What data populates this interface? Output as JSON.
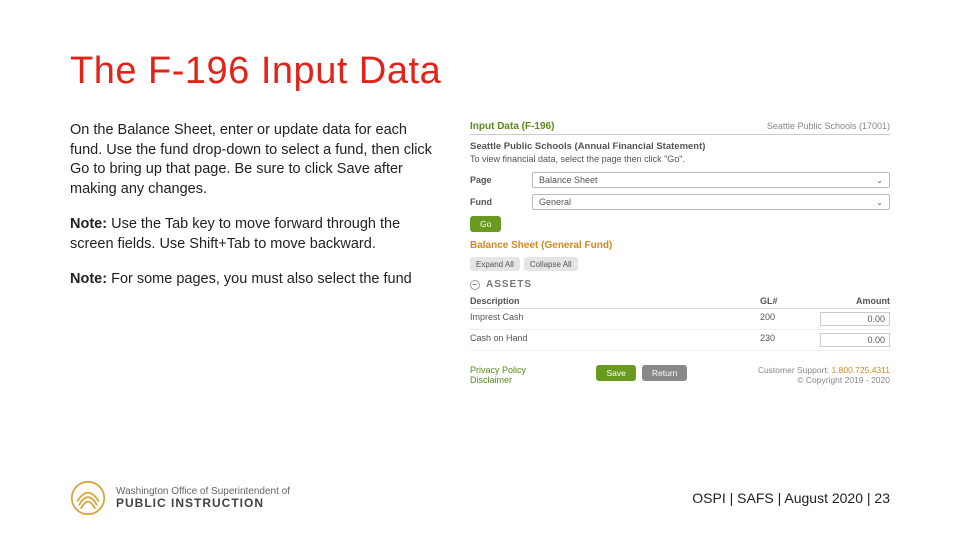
{
  "title": "The F-196 Input Data",
  "left": {
    "p1": "On the Balance Sheet, enter or update data for each fund. Use the fund drop-down to select a fund, then click Go to bring up that page. Be sure to click Save after making any changes.",
    "note1_label": "Note:",
    "note1_text": " Use the Tab key to move forward through the screen fields. Use Shift+Tab to move backward.",
    "note2_label": "Note:",
    "note2_text": " For some pages, you must also select the fund"
  },
  "panel": {
    "title": "Input Data (F-196)",
    "district": "Seattle Public Schools (17001)",
    "subtitle": "Seattle Public Schools (Annual Financial Statement)",
    "instruction": "To view financial data, select the page then click \"Go\".",
    "page_label": "Page",
    "page_value": "Balance Sheet",
    "fund_label": "Fund",
    "fund_value": "General",
    "go": "Go",
    "section": "Balance Sheet (General Fund)",
    "expand": "Expand All",
    "collapse": "Collapse All",
    "assets": "ASSETS",
    "cols": {
      "desc": "Description",
      "gl": "GL#",
      "amount": "Amount"
    },
    "rows": [
      {
        "desc": "Imprest Cash",
        "gl": "200",
        "amount": "0.00"
      },
      {
        "desc": "Cash on Hand",
        "gl": "230",
        "amount": "0.00"
      }
    ],
    "privacy": "Privacy Policy",
    "disclaimer": "Disclaimer",
    "save": "Save",
    "return": "Return",
    "support_label": "Customer Support:",
    "support_phone": "1.800.725.4311",
    "copyright": "© Copyright 2019 - 2020"
  },
  "logo": {
    "line1": "Washington Office of Superintendent of",
    "line2": "PUBLIC INSTRUCTION"
  },
  "footer": "OSPI | SAFS |   August 2020 |  23"
}
